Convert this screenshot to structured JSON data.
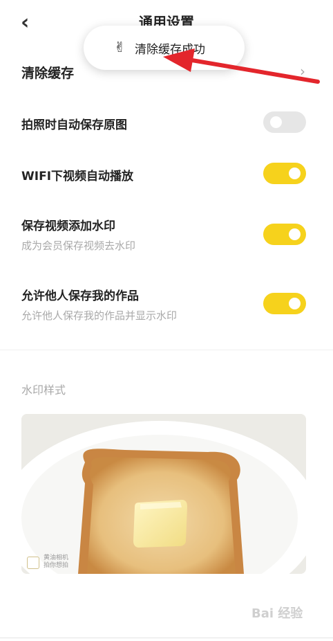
{
  "header": {
    "title": "通用设置",
    "back_icon": "chevron-left-icon"
  },
  "toast": {
    "emoji": "✌",
    "message": "清除缓存成功"
  },
  "settings": {
    "clear_cache": {
      "label": "清除缓存",
      "chevron": "›"
    },
    "save_original": {
      "label": "拍照时自动保存原图",
      "enabled": false
    },
    "wifi_autoplay": {
      "label": "WIFI下视频自动播放",
      "enabled": true
    },
    "save_watermark": {
      "label": "保存视频添加水印",
      "sub": "成为会员保存视频去水印",
      "enabled": true
    },
    "allow_save": {
      "label": "允许他人保存我的作品",
      "sub": "允许他人保存我的作品并显示水印",
      "enabled": true
    }
  },
  "watermark_section": {
    "title": "水印样式"
  },
  "preview": {
    "stamp_line1": "黄油相机",
    "stamp_line2": "拍你想拍"
  },
  "watermark": {
    "text": "Bai 经验"
  },
  "colors": {
    "accent": "#f6d21c",
    "toggle_off": "#e6e6e6",
    "arrow": "#e3262c"
  }
}
